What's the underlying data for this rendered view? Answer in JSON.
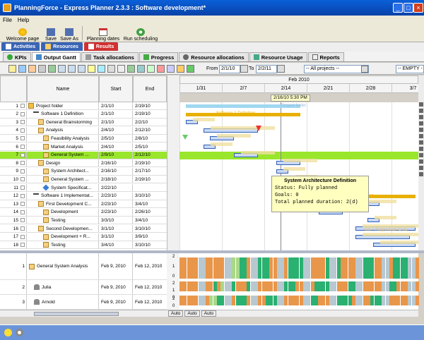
{
  "window": {
    "title": "PlanningForce - Express Planner 2.3.3 : Software development*"
  },
  "menu": [
    "File",
    "Help"
  ],
  "toolbar": [
    {
      "label": "Welcome page",
      "icon": "star-icon"
    },
    {
      "label": "Save",
      "icon": "floppy-icon"
    },
    {
      "label": "Save As",
      "icon": "floppy-as-icon"
    },
    {
      "label": "Planning dates",
      "icon": "calendar-icon"
    },
    {
      "label": "Run scheduling",
      "icon": "gear-icon"
    }
  ],
  "mode_tabs": [
    {
      "label": "Activities",
      "active": false
    },
    {
      "label": "Resources",
      "active": false
    },
    {
      "label": "Results",
      "active": true
    }
  ],
  "view_tabs": [
    {
      "label": "KPIs",
      "active": false
    },
    {
      "label": "Output Gantt",
      "active": true
    },
    {
      "label": "Task allocations",
      "active": false
    },
    {
      "label": "Progress",
      "active": false
    },
    {
      "label": "Resource allocations",
      "active": false
    },
    {
      "label": "Resource Usage",
      "active": false
    },
    {
      "label": "Reports",
      "active": false
    }
  ],
  "gantt_toolbar": {
    "from_label": "From",
    "from_value": "2/1/10",
    "to_label": "To",
    "to_value": "2/2/11",
    "projects_filter": "-- All projects --",
    "empty_filter": "-- EMPTY -"
  },
  "grid": {
    "columns": [
      "Name",
      "Start",
      "End"
    ],
    "rows": [
      {
        "num": "1",
        "name": "Project folder",
        "start": "2/1/10",
        "end": "2/19/10",
        "icon": "folder-icon",
        "indent": 0,
        "sel": false
      },
      {
        "num": "2",
        "name": "Software 1 Definition",
        "start": "2/1/10",
        "end": "2/19/10",
        "icon": "project-icon",
        "indent": 1,
        "sel": false
      },
      {
        "num": "3",
        "name": "General Brainstorming",
        "start": "2/1/10",
        "end": "2/2/10",
        "icon": "task-icon",
        "indent": 2,
        "sel": false
      },
      {
        "num": "4",
        "name": "Analysis",
        "start": "2/4/10",
        "end": "2/12/10",
        "icon": "task-icon",
        "indent": 2,
        "sel": false
      },
      {
        "num": "5",
        "name": "Feasibility Analysis",
        "start": "2/5/10",
        "end": "2/8/10",
        "icon": "task-icon",
        "indent": 3,
        "sel": false
      },
      {
        "num": "6",
        "name": "Market Analysis",
        "start": "2/4/10",
        "end": "2/5/10",
        "icon": "task-icon",
        "indent": 3,
        "sel": false
      },
      {
        "num": "7",
        "name": "General System ...",
        "start": "2/9/10",
        "end": "2/12/10",
        "icon": "task-icon",
        "indent": 3,
        "sel": true
      },
      {
        "num": "8",
        "name": "Design",
        "start": "2/16/10",
        "end": "2/19/10",
        "icon": "task-icon",
        "indent": 2,
        "sel": false
      },
      {
        "num": "9",
        "name": "System Architect...",
        "start": "2/16/10",
        "end": "2/17/10",
        "icon": "task-icon",
        "indent": 3,
        "sel": false
      },
      {
        "num": "10",
        "name": "General System ...",
        "start": "2/18/10",
        "end": "2/19/10",
        "icon": "task-icon",
        "indent": 3,
        "sel": false
      },
      {
        "num": "11",
        "name": "System Specificat...",
        "start": "2/22/10",
        "end": "",
        "icon": "diamond-icon",
        "indent": 3,
        "sel": false
      },
      {
        "num": "12",
        "name": "Software 1 Implementat...",
        "start": "2/23/10",
        "end": "3/10/10",
        "icon": "project-icon",
        "indent": 1,
        "sel": false
      },
      {
        "num": "13",
        "name": "First Development C...",
        "start": "2/23/10",
        "end": "3/4/10",
        "icon": "task-icon",
        "indent": 2,
        "sel": false
      },
      {
        "num": "14",
        "name": "Development",
        "start": "2/23/10",
        "end": "2/26/10",
        "icon": "task-icon",
        "indent": 3,
        "sel": false
      },
      {
        "num": "15",
        "name": "Testing",
        "start": "3/3/10",
        "end": "3/4/10",
        "icon": "task-icon",
        "indent": 3,
        "sel": false
      },
      {
        "num": "16",
        "name": "Second Developmen...",
        "start": "3/1/10",
        "end": "3/10/10",
        "icon": "task-icon",
        "indent": 2,
        "sel": false
      },
      {
        "num": "17",
        "name": "Development + R...",
        "start": "3/1/10",
        "end": "3/9/10",
        "icon": "task-icon",
        "indent": 3,
        "sel": false
      },
      {
        "num": "18",
        "name": "Testing",
        "start": "3/4/10",
        "end": "3/10/10",
        "icon": "task-icon",
        "indent": 3,
        "sel": false
      }
    ]
  },
  "timeline": {
    "month": "Feb 2010",
    "weeks": [
      "1/31",
      "2/7",
      "2/14",
      "2/21",
      "2/28",
      "3/7"
    ],
    "cursor_label": "2/16/10 5:30 PM"
  },
  "gantt_labels": {
    "project_folder": "Project folder",
    "software_def": "Software 1 Definition",
    "dev_hint": "ation",
    "dev_hint2": "ent + Regression Crea"
  },
  "tooltip": {
    "title": "System Architecture Definition",
    "lines": [
      "Status: Fully planned",
      "Goals: 0",
      "Total planned duration: 2(d)"
    ]
  },
  "resource_grid": {
    "rows": [
      {
        "num": "1",
        "name": "General System Analysis",
        "start": "Feb 9, 2010",
        "end": "Feb 12, 2010",
        "icon": "task-icon"
      },
      {
        "num": "2",
        "name": "Julia",
        "start": "Feb 9, 2010",
        "end": "Feb 12, 2010",
        "icon": "person-icon"
      },
      {
        "num": "3",
        "name": "Arnold",
        "start": "Feb 9, 2010",
        "end": "Feb 12, 2010",
        "icon": "person-icon"
      }
    ],
    "axis_labels": [
      "2",
      "1",
      "0",
      "2",
      "1",
      "0",
      "2",
      "0"
    ],
    "auto_buttons": [
      "Auto",
      "Auto",
      "Auto"
    ]
  },
  "colors": {
    "selected_row": "#9ae62c",
    "summary_bar": "#e8b000",
    "task_bar": "#c8d8f8",
    "orange_cell": "#e8964a",
    "green_cell": "#2ab070",
    "lightgreen_cell": "#a8d888",
    "gray_cell": "#b8c8d0"
  }
}
